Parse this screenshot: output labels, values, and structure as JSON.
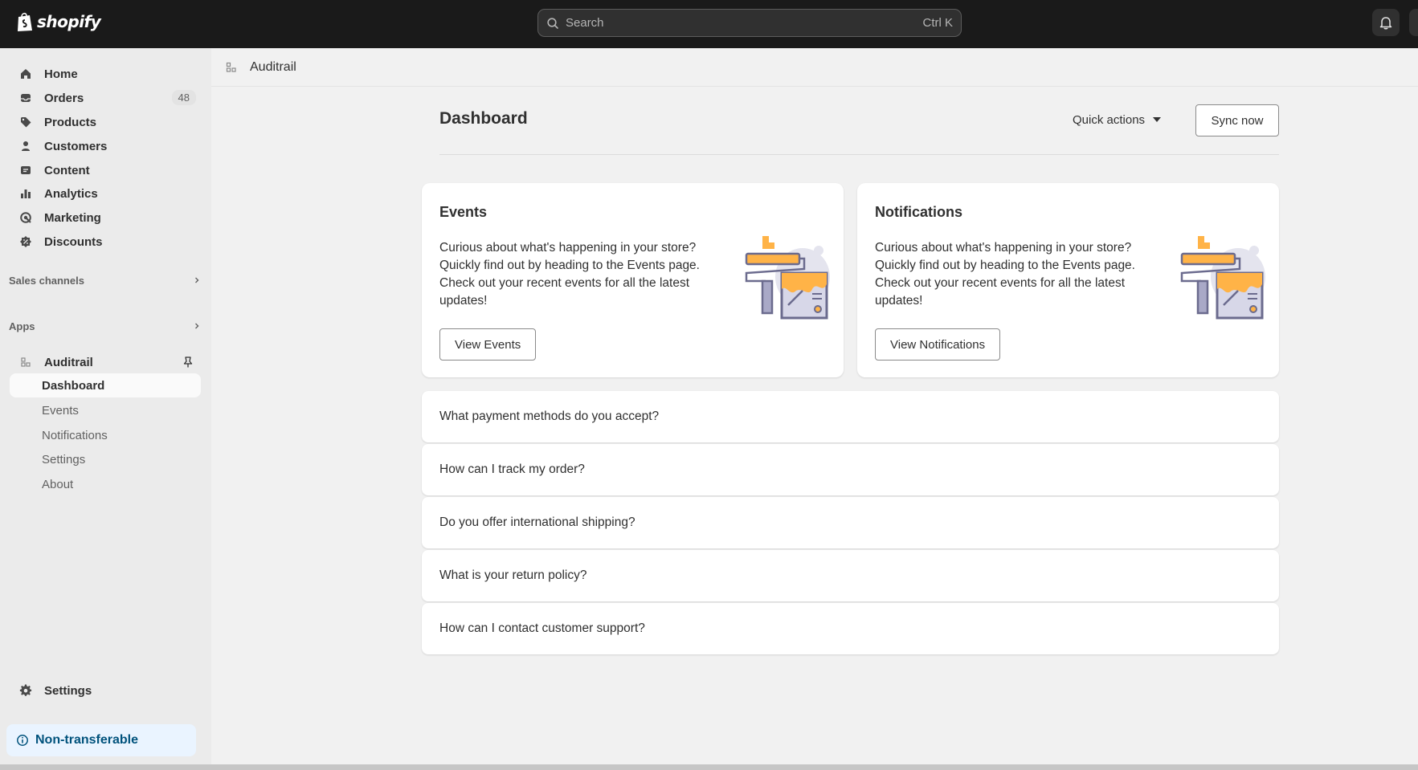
{
  "topbar": {
    "logo_text": "shopify",
    "search_placeholder": "Search",
    "search_shortcut": "Ctrl K"
  },
  "sidebar": {
    "items": [
      {
        "label": "Home",
        "icon": "home-icon"
      },
      {
        "label": "Orders",
        "icon": "inbox-icon",
        "badge": "48"
      },
      {
        "label": "Products",
        "icon": "tag-icon"
      },
      {
        "label": "Customers",
        "icon": "person-icon"
      },
      {
        "label": "Content",
        "icon": "content-icon"
      },
      {
        "label": "Analytics",
        "icon": "bar-chart-icon"
      },
      {
        "label": "Marketing",
        "icon": "target-icon"
      },
      {
        "label": "Discounts",
        "icon": "discount-icon"
      }
    ],
    "sales_channels_label": "Sales channels",
    "apps_label": "Apps",
    "app_name": "Auditrail",
    "app_subitems": [
      "Dashboard",
      "Events",
      "Notifications",
      "Settings",
      "About"
    ],
    "settings_label": "Settings",
    "non_transferable_label": "Non-transferable"
  },
  "appbar": {
    "title": "Auditrail"
  },
  "main": {
    "title": "Dashboard",
    "quick_actions_label": "Quick actions",
    "sync_label": "Sync now",
    "cards": [
      {
        "title": "Events",
        "body": "Curious about what's happening in your store? Quickly find out by heading to the Events page. Check out your recent events for all the latest updates!",
        "button": "View Events"
      },
      {
        "title": "Notifications",
        "body": "Curious about what's happening in your store? Quickly find out by heading to the Events page. Check out your recent events for all the latest updates!",
        "button": "View Notifications"
      }
    ],
    "faqs": [
      "What payment methods do you accept?",
      "How can I track my order?",
      "Do you offer international shipping?",
      "What is your return policy?",
      "How can I contact customer support?"
    ]
  },
  "colors": {
    "topbar": "#1a1a1a",
    "sidebar": "#ebebeb",
    "page": "#f1f1f1",
    "accent_orange": "#ffb347",
    "illustration_purple": "#6b6b8e",
    "info_blue": "#00527c"
  }
}
